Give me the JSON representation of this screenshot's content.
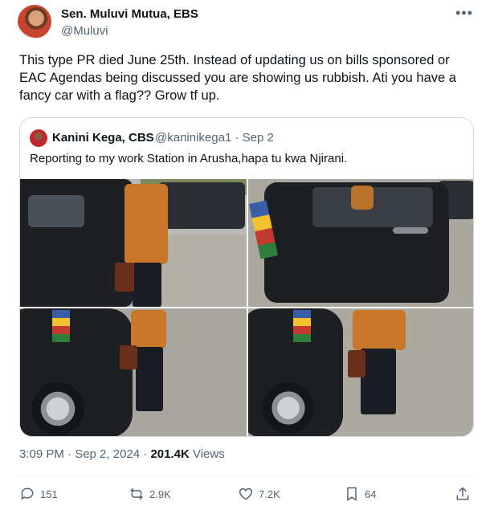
{
  "author": {
    "name": "Sen. Muluvi Mutua, EBS",
    "handle": "@Muluvi"
  },
  "more_icon": "more-horizontal-icon",
  "text": "This type PR died June 25th. Instead of updating us on bills sponsored or EAC Agendas being discussed you are showing us rubbish. Ati you have a fancy car with a flag?? Grow tf up.",
  "quote": {
    "name": "Kanini Kega, CBS",
    "handle": "@kaninikega1 · Sep 2",
    "text": "Reporting to my work Station in Arusha,hapa tu kwa Njirani."
  },
  "meta": {
    "time": "3:09 PM · Sep 2, 2024 · ",
    "views": "201.4K",
    "views_label": " Views"
  },
  "actions": {
    "replies": "151",
    "reposts": "2.9K",
    "likes": "7.2K",
    "bookmarks": "64"
  },
  "colors": {
    "text": "#0f1419",
    "secondary": "#536471",
    "border": "#cfd9de",
    "shirt": "#c9782a"
  }
}
